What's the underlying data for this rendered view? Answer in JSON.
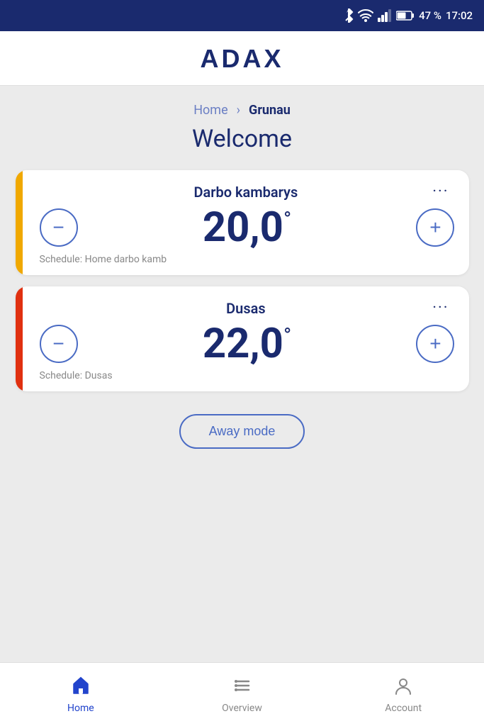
{
  "statusBar": {
    "battery": "47 %",
    "time": "17:02"
  },
  "header": {
    "logo": "ADAX"
  },
  "breadcrumb": {
    "home": "Home",
    "active": "Grunau"
  },
  "welcome": "Welcome",
  "devices": [
    {
      "id": "darbo",
      "name": "Darbo kambarys",
      "temperature": "20,0",
      "accentColor": "#f0a800",
      "schedule": "Schedule: Home darbo kamb",
      "moreLabel": "···"
    },
    {
      "id": "dusas",
      "name": "Dusas",
      "temperature": "22,0",
      "accentColor": "#e03010",
      "schedule": "Schedule: Dusas",
      "moreLabel": "···"
    }
  ],
  "awayMode": "Away mode",
  "nav": {
    "items": [
      {
        "id": "home",
        "label": "Home",
        "active": true
      },
      {
        "id": "overview",
        "label": "Overview",
        "active": false
      },
      {
        "id": "account",
        "label": "Account",
        "active": false
      }
    ]
  }
}
